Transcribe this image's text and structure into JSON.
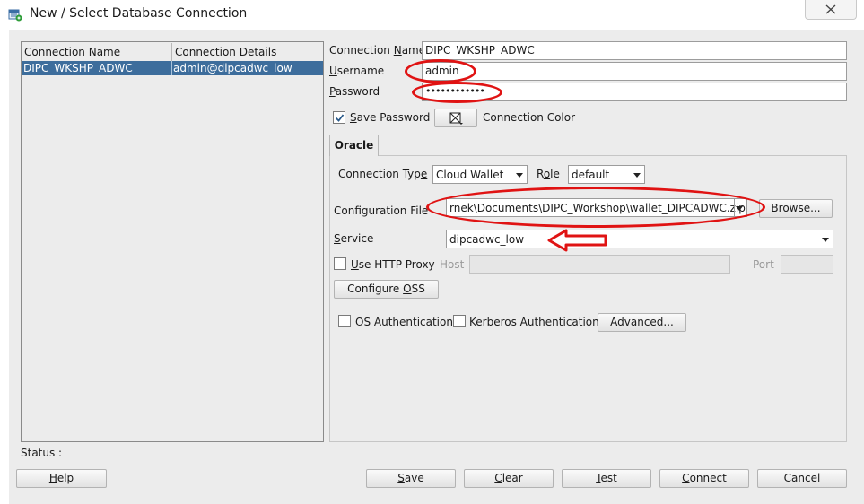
{
  "window": {
    "title": "New / Select Database Connection",
    "close_icon": "close-icon",
    "app_icon": "database-connection-icon"
  },
  "connections": {
    "columns": [
      "Connection Name",
      "Connection Details"
    ],
    "rows": [
      {
        "name": "DIPC_WKSHP_ADWC",
        "details": "admin@dipcadwc_low",
        "selected": true
      }
    ]
  },
  "form": {
    "connection_name_label": "Connection Name",
    "connection_name_value": "DIPC_WKSHP_ADWC",
    "username_label": "Username",
    "username_value": "admin",
    "password_label": "Password",
    "password_value": "••••••••••••",
    "save_password_label": "Save Password",
    "save_password_checked": true,
    "connection_color_label": "Connection Color"
  },
  "tabs": [
    {
      "label": "Oracle",
      "active": true
    }
  ],
  "oracle": {
    "connection_type_label": "Connection Type",
    "connection_type_value": "Cloud Wallet",
    "role_label": "Role",
    "role_value": "default",
    "config_file_label": "Configuration File",
    "config_file_value": "rnek\\Documents\\DIPC_Workshop\\wallet_DIPCADWC.zip",
    "browse_label": "Browse...",
    "service_label": "Service",
    "service_value": "dipcadwc_low",
    "use_http_proxy_label": "Use HTTP Proxy",
    "use_http_proxy_checked": false,
    "host_label": "Host",
    "host_value": "",
    "port_label": "Port",
    "port_value": "",
    "configure_oss_label": "Configure OSS",
    "os_auth_label": "OS Authentication",
    "os_auth_checked": false,
    "kerberos_label": "Kerberos Authentication",
    "kerberos_checked": false,
    "advanced_label": "Advanced..."
  },
  "status": {
    "label": "Status :",
    "value": ""
  },
  "buttons": {
    "help": "Help",
    "save": "Save",
    "clear": "Clear",
    "test": "Test",
    "connect": "Connect",
    "cancel": "Cancel"
  },
  "annotations": {
    "highlight_color": "#e01313"
  },
  "colors": {
    "selection": "#3d6d9c",
    "dialog_bg": "#ececec"
  }
}
